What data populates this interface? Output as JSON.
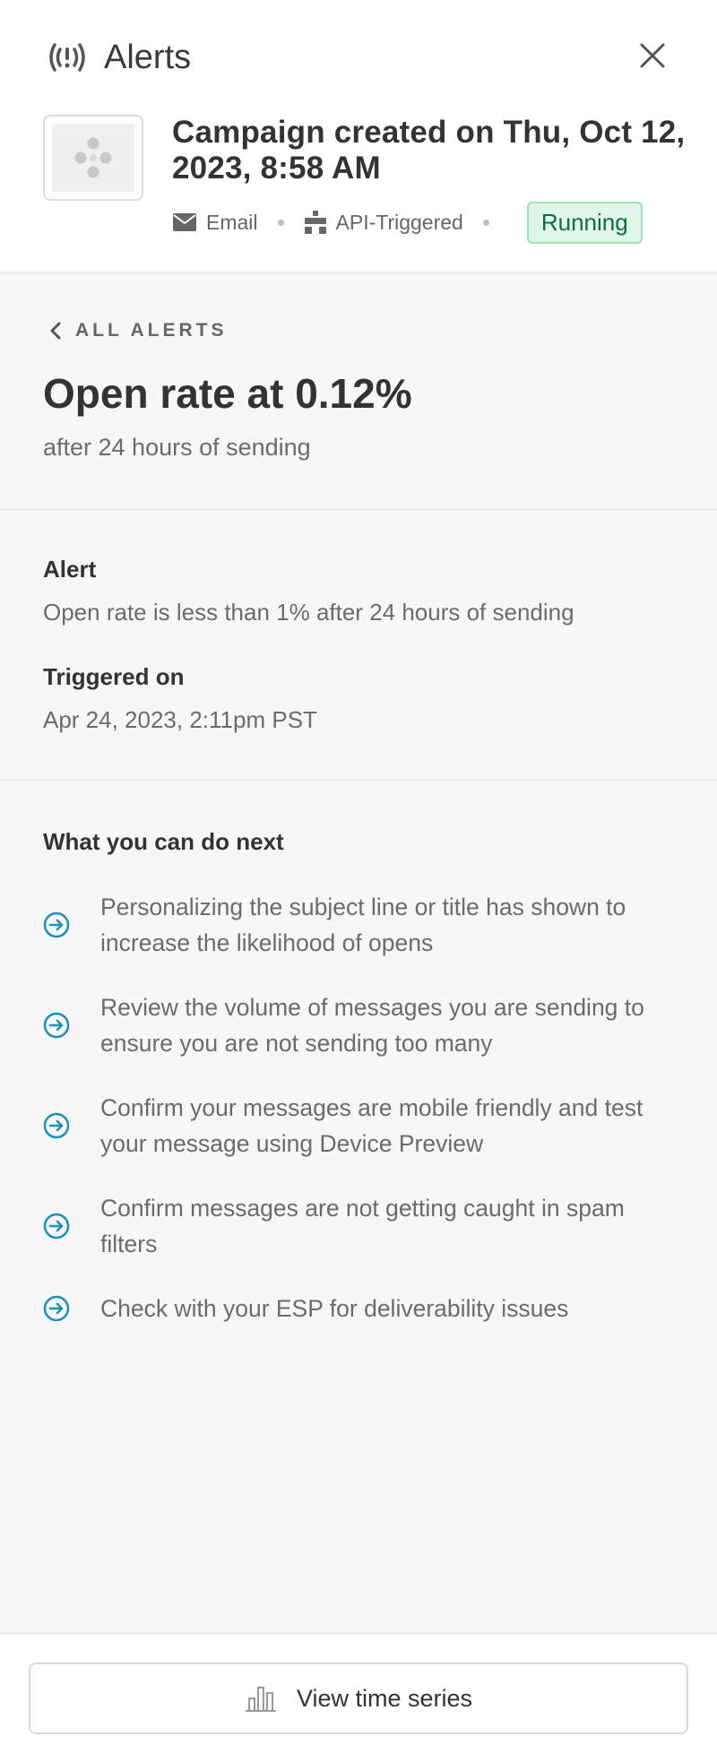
{
  "header": {
    "title": "Alerts",
    "campaign_title": "Campaign created on Thu, Oct 12, 2023, 8:58 AM",
    "meta": {
      "channel": "Email",
      "trigger": "API-Triggered",
      "status": "Running"
    }
  },
  "detail": {
    "back_label": "ALL ALERTS",
    "headline": "Open rate at 0.12%",
    "subhead": "after 24 hours of sending",
    "alert_label": "Alert",
    "alert_value": "Open rate is less than 1% after 24 hours of sending",
    "triggered_label": "Triggered on",
    "triggered_value": "Apr 24, 2023, 2:11pm PST"
  },
  "next_steps": {
    "title": "What you can do next",
    "items": [
      "Personalizing the subject line or title has shown to increase the likelihood of opens",
      "Review the volume of messages you are sending to ensure you are not sending too many",
      "Confirm your messages are mobile friendly and test your message using Device Preview",
      "Confirm messages are not getting caught in spam filters",
      "Check with your ESP for deliverability issues"
    ]
  },
  "footer": {
    "button_label": "View time series"
  },
  "colors": {
    "accent_teal": "#1f8fb3",
    "status_bg": "#dff6ea",
    "status_text": "#146a40"
  },
  "icons": {
    "alerts": "alert-broadcast-icon",
    "close": "close-icon",
    "back": "chevron-left-icon",
    "email": "envelope-icon",
    "api": "api-trigger-icon",
    "next": "arrow-circle-right-icon",
    "chart": "bar-chart-icon"
  }
}
